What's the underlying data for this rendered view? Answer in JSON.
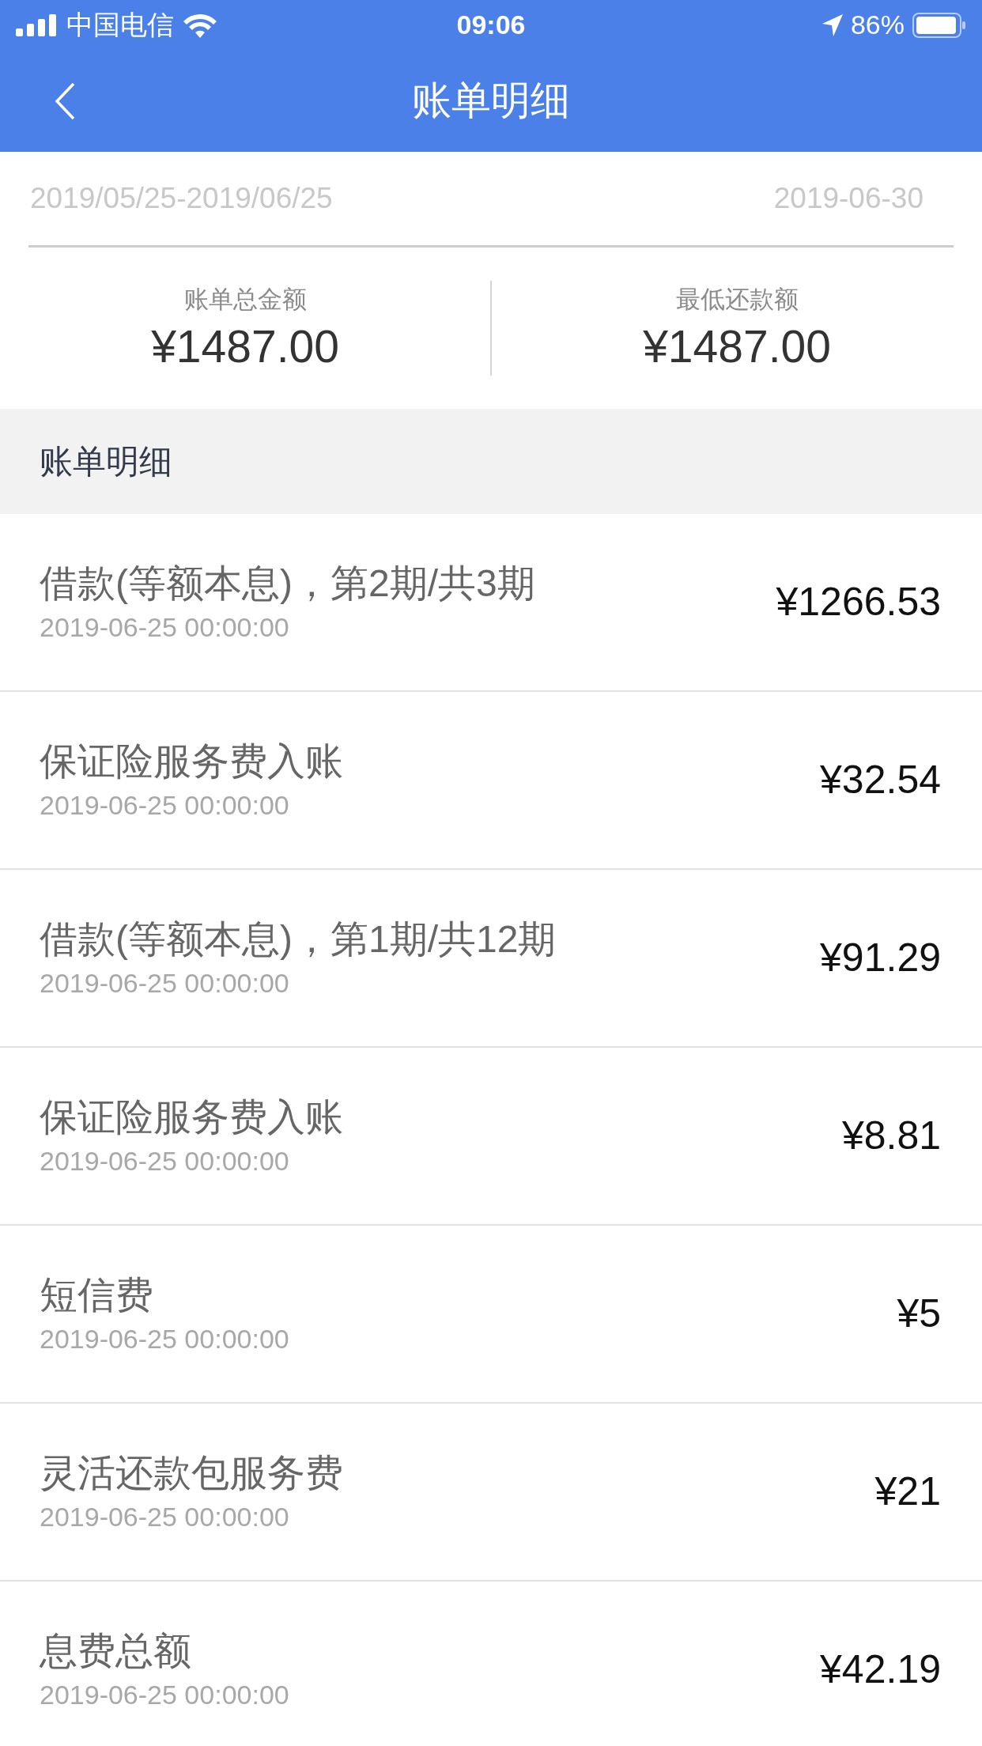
{
  "status_bar": {
    "carrier": "中国电信",
    "time": "09:06",
    "battery": "86%"
  },
  "nav": {
    "title": "账单明细"
  },
  "period": {
    "range": "2019/05/25-2019/06/25",
    "due_date": "2019-06-30"
  },
  "summary": [
    {
      "label": "账单总金额",
      "value": "¥1487.00"
    },
    {
      "label": "最低还款额",
      "value": "¥1487.00"
    }
  ],
  "section": {
    "title": "账单明细"
  },
  "items": [
    {
      "title": "借款(等额本息)，第2期/共3期",
      "time": "2019-06-25 00:00:00",
      "amount": "¥1266.53"
    },
    {
      "title": "保证险服务费入账",
      "time": "2019-06-25 00:00:00",
      "amount": "¥32.54"
    },
    {
      "title": "借款(等额本息)，第1期/共12期",
      "time": "2019-06-25 00:00:00",
      "amount": "¥91.29"
    },
    {
      "title": "保证险服务费入账",
      "time": "2019-06-25 00:00:00",
      "amount": "¥8.81"
    },
    {
      "title": "短信费",
      "time": "2019-06-25 00:00:00",
      "amount": "¥5"
    },
    {
      "title": "灵活还款包服务费",
      "time": "2019-06-25 00:00:00",
      "amount": "¥21"
    },
    {
      "title": "息费总额",
      "time": "2019-06-25 00:00:00",
      "amount": "¥42.19"
    }
  ]
}
